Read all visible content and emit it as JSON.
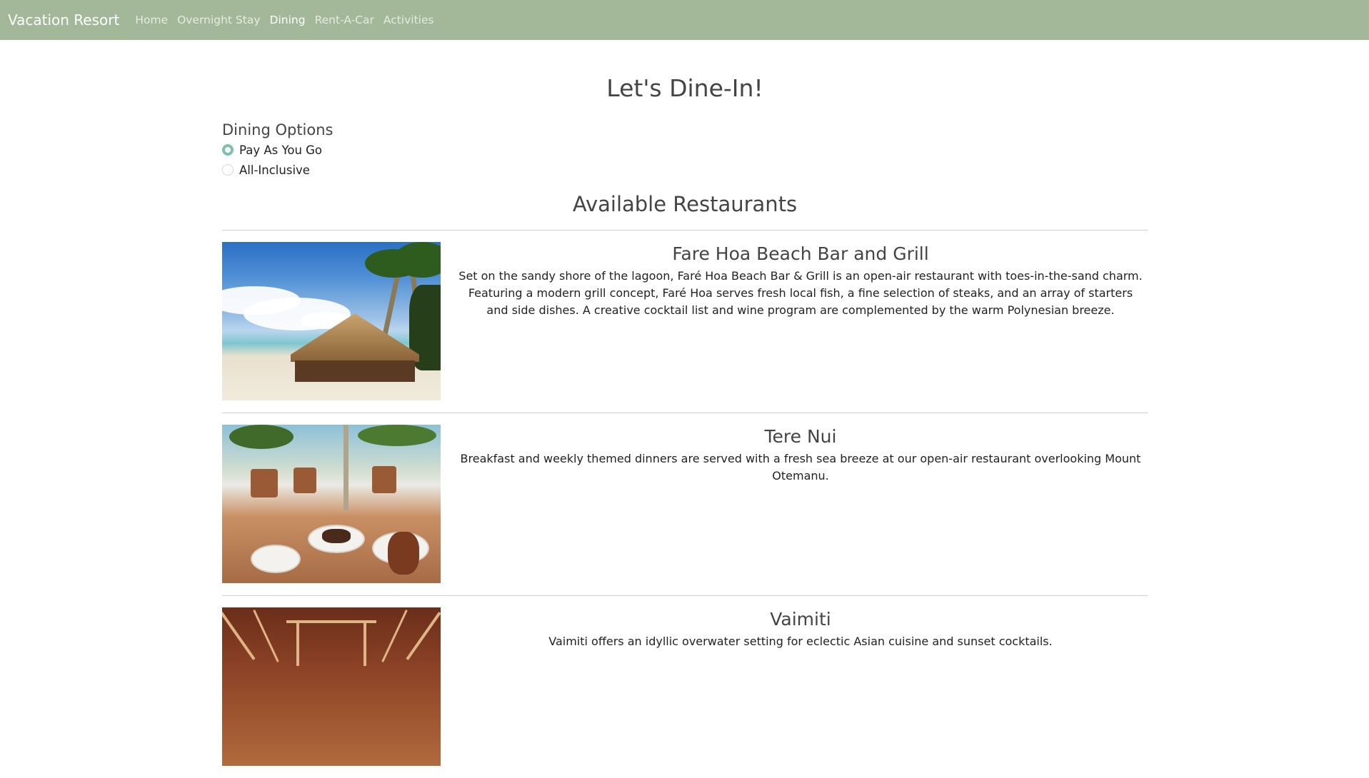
{
  "navbar": {
    "brand": "Vacation Resort",
    "links": [
      "Home",
      "Overnight Stay",
      "Dining",
      "Rent-A-Car",
      "Activities"
    ],
    "active": "Dining"
  },
  "page": {
    "title": "Let's Dine-In!"
  },
  "dining_options": {
    "heading": "Dining Options",
    "options": [
      "Pay As You Go",
      "All-Inclusive"
    ],
    "selected": "Pay As You Go"
  },
  "restaurants_section": {
    "title": "Available Restaurants",
    "items": [
      {
        "name": "Fare Hoa Beach Bar and Grill",
        "description": "Set on the sandy shore of the lagoon, Faré Hoa Beach Bar & Grill is an open-air restaurant with toes-in-the-sand charm. Featuring a modern grill concept, Faré Hoa serves fresh local fish, a fine selection of steaks, and an array of starters and side dishes. A creative cocktail list and wine program are complemented by the warm Polynesian breeze.",
        "image": "beach-hut-photo"
      },
      {
        "name": "Tere Nui",
        "description": "Breakfast and weekly themed dinners are served with a fresh sea breeze at our open-air restaurant overlooking Mount Otemanu.",
        "image": "breakfast-table-photo"
      },
      {
        "name": "Vaimiti",
        "description": "Vaimiti offers an idyllic overwater setting for eclectic Asian cuisine and sunset cocktails.",
        "image": "overwater-restaurant-photo"
      }
    ]
  },
  "colors": {
    "navbar_bg": "#a2b899",
    "radio_accent": "#7fbfb0",
    "heading_text": "#444444"
  }
}
